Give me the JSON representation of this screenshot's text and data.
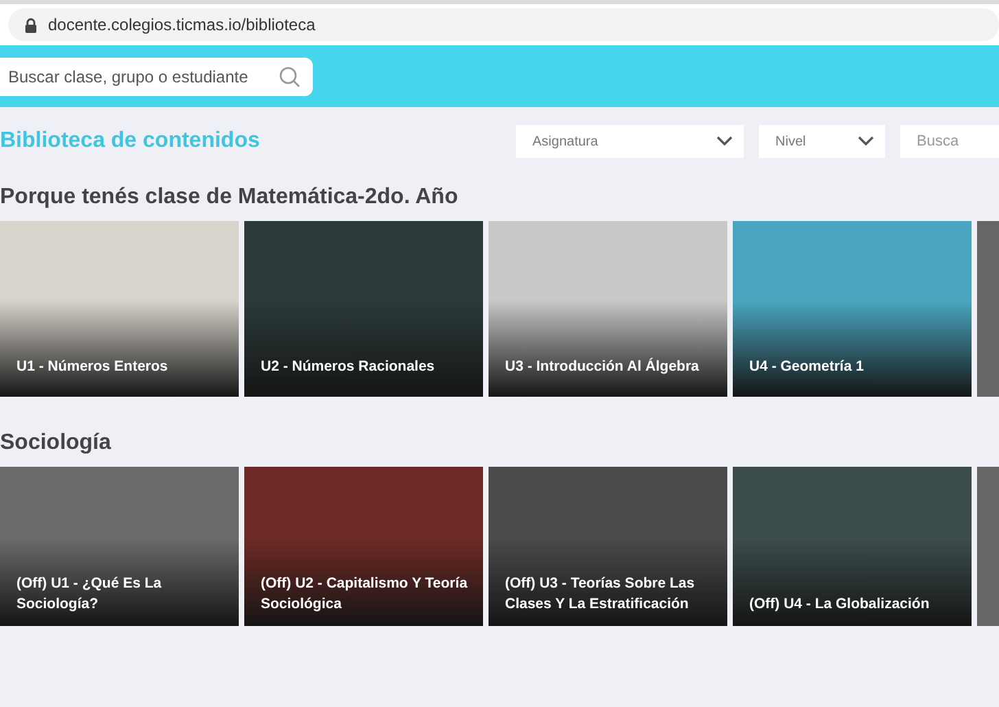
{
  "browser": {
    "url": "docente.colegios.ticmas.io/biblioteca"
  },
  "header": {
    "search": {
      "placeholder": "Buscar clase, grupo o estudiante"
    }
  },
  "library": {
    "title": "Biblioteca de contenidos",
    "filters": [
      {
        "kind": "select",
        "label": "Asignatura"
      },
      {
        "kind": "select",
        "label": "Nivel"
      },
      {
        "kind": "field",
        "label": "Busca"
      }
    ]
  },
  "sections": [
    {
      "title": "Porque tenés clase de Matemática-2do. Año",
      "cards": [
        {
          "title": "U1 - Números Enteros",
          "color": "#d8d4cc"
        },
        {
          "title": "U2 - Números Racionales",
          "color": "#2c3a3a"
        },
        {
          "title": "U3 - Introducción Al Álgebra",
          "color": "#c8c8c6"
        },
        {
          "title": "U4 - Geometría 1",
          "color": "#4aa6c0"
        }
      ]
    },
    {
      "title": "Sociología",
      "cards": [
        {
          "title": "(Off) U1 - ¿Qué Es La Sociología?",
          "color": "#6a6a6a"
        },
        {
          "title": "(Off) U2 - Capitalismo Y Teoría Sociológica",
          "color": "#6e2a24"
        },
        {
          "title": "(Off) U3 - Teorías Sobre Las Clases Y La Estratificación",
          "color": "#4a4a4a"
        },
        {
          "title": "(Off) U4 - La Globalización",
          "color": "#3c4c4c"
        }
      ]
    }
  ]
}
